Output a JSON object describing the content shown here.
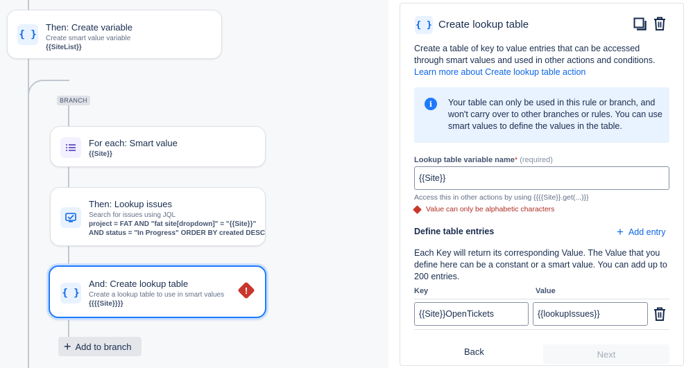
{
  "flow": {
    "create_variable": {
      "title": "Then: Create variable",
      "subtitle": "Create smart value variable",
      "value": "{{SiteList}}",
      "icon": "braces-icon"
    },
    "branch_tag": "BRANCH",
    "for_each": {
      "title": "For each: Smart value",
      "value": "{{Site}}",
      "icon": "list-icon"
    },
    "lookup_issues": {
      "title": "Then: Lookup issues",
      "subtitle": "Search for issues using JQL",
      "jql_line1": "project = FAT AND \"fat site[dropdown]\" = \"{{Site}}\"",
      "jql_line2": "AND status = \"In Progress\" ORDER BY created DESC",
      "icon": "search-screen-icon"
    },
    "create_lookup": {
      "title": "And: Create lookup table",
      "subtitle": "Create a lookup table to use in smart values",
      "value": "{{{{Site}}}}",
      "icon": "braces-icon",
      "status": "error-icon"
    },
    "add_to_branch": "Add to branch"
  },
  "panel": {
    "title": "Create lookup table",
    "description": "Create a table of key to value entries that can be accessed through smart values and used in other actions and conditions.",
    "learn_more": "Learn more about Create lookup table action",
    "info": "Your table can only be used in this rule or branch, and won't carry over to other branches or rules. You can use smart values to define the values in the table.",
    "name_label": "Lookup table variable name",
    "required_mark": "*",
    "required_text": "(required)",
    "name_value": "{{Site}}",
    "help_text": "Access this in other actions by using {{{{Site}}.get(...)}}",
    "error_text": "Value can only be alphabetic characters",
    "section_title": "Define table entries",
    "add_entry": "Add entry",
    "entries_desc": "Each Key will return its corresponding Value. The Value that you define here can be a constant or a smart value. You can add up to 200 entries.",
    "key_header": "Key",
    "value_header": "Value",
    "entries": [
      {
        "key": "{{Site}}OpenTickets",
        "value": "{{lookupIssues}}"
      }
    ],
    "back_label": "Back",
    "next_label": "Next"
  },
  "colors": {
    "accent": "#0c66e4",
    "error": "#c9372c",
    "selected_border": "#1d7afc"
  }
}
